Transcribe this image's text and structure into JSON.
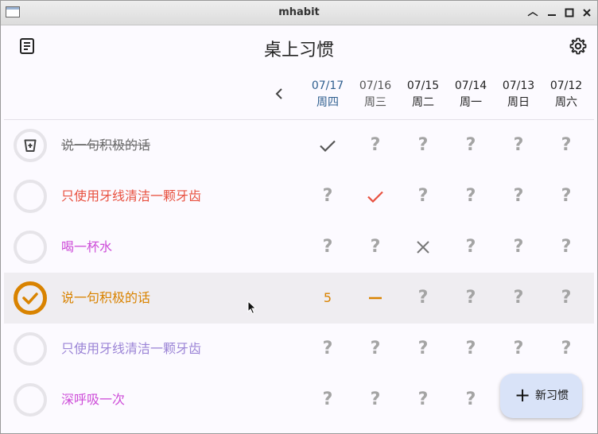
{
  "window": {
    "title": "mhabit"
  },
  "header": {
    "title": "桌上习惯"
  },
  "dates": [
    {
      "date": "07/17",
      "weekday": "周四"
    },
    {
      "date": "07/16",
      "weekday": "周三"
    },
    {
      "date": "07/15",
      "weekday": "周二"
    },
    {
      "date": "07/14",
      "weekday": "周一"
    },
    {
      "date": "07/13",
      "weekday": "周日"
    },
    {
      "date": "07/12",
      "weekday": "周六"
    }
  ],
  "habits": [
    {
      "name": "说一句积极的话",
      "color": "#6b6b6b",
      "archived": true,
      "cells": [
        "check",
        "?",
        "?",
        "?",
        "?",
        "?"
      ]
    },
    {
      "name": "只使用牙线清洁一颗牙齿",
      "color": "#e8503f",
      "cells": [
        "?",
        "check",
        "?",
        "?",
        "?",
        "?"
      ]
    },
    {
      "name": "喝一杯水",
      "color": "#cd4cd8",
      "cells": [
        "?",
        "?",
        "x",
        "?",
        "?",
        "?"
      ]
    },
    {
      "name": "说一句积极的话",
      "color": "#d98300",
      "selected": true,
      "completed": true,
      "cells": [
        "5",
        "dash",
        "?",
        "?",
        "?",
        "?"
      ]
    },
    {
      "name": "只使用牙线清洁一颗牙齿",
      "color": "#9b84d6",
      "cells": [
        "?",
        "?",
        "?",
        "?",
        "?",
        "?"
      ]
    },
    {
      "name": "深呼吸一次",
      "color": "#cd4cd8",
      "cells": [
        "?",
        "?",
        "?",
        "?",
        "?",
        "?"
      ]
    }
  ],
  "fab": {
    "label": "新习惯"
  },
  "icons": {
    "menu": "list-icon",
    "settings": "gear-icon",
    "prev": "chevron-left-icon"
  }
}
